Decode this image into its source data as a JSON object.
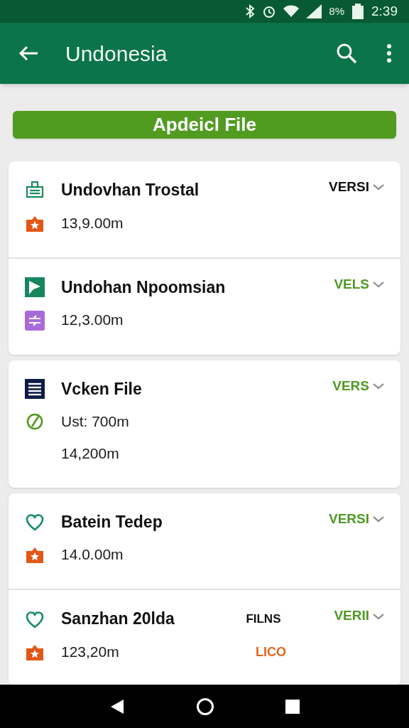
{
  "status_bar": {
    "battery": "8%",
    "time": "2:39"
  },
  "app_bar": {
    "title": "Undonesia"
  },
  "primary_button": {
    "label": "Apdeicl File"
  },
  "cards": [
    {
      "rows": [
        {
          "title": "Undovhan Trostal",
          "kind": "clipboard",
          "lines": [
            {
              "text": "13,9.00m",
              "kind": "bag-star"
            }
          ],
          "tag": {
            "text": "VERSI",
            "color": "#111111"
          }
        },
        {
          "title": "Undohan Npoomsian",
          "kind": "flag",
          "lines": [
            {
              "text": "12,3.00m",
              "kind": "swap"
            }
          ],
          "tag": {
            "text": "VELS",
            "color": "#4f9a23"
          }
        }
      ]
    },
    {
      "rows": [
        {
          "title": "Vcken File",
          "kind": "list",
          "lines": [
            {
              "text": "Ust:  700m",
              "kind": "clock"
            },
            {
              "text": "14,200m",
              "kind": "plain"
            }
          ],
          "tag": {
            "text": "VERS",
            "color": "#4f9a23"
          }
        }
      ]
    },
    {
      "rows": [
        {
          "title": "Batein Tedep",
          "kind": "heart",
          "lines": [
            {
              "text": "14.0.00m",
              "kind": "bag-star"
            }
          ],
          "tag": {
            "text": "VERSI",
            "color": "#4f9a23"
          }
        },
        {
          "title": "Sanzhan 20lda",
          "kind": "heart",
          "lines": [
            {
              "text": "123,20m",
              "kind": "bag-star"
            }
          ],
          "tag": {
            "text": "VERII",
            "color": "#4f9a23"
          },
          "aside": [
            {
              "text": "FILNS",
              "color": "#111111"
            },
            {
              "text": "LICO",
              "color": "#e0661a"
            }
          ]
        }
      ]
    }
  ]
}
